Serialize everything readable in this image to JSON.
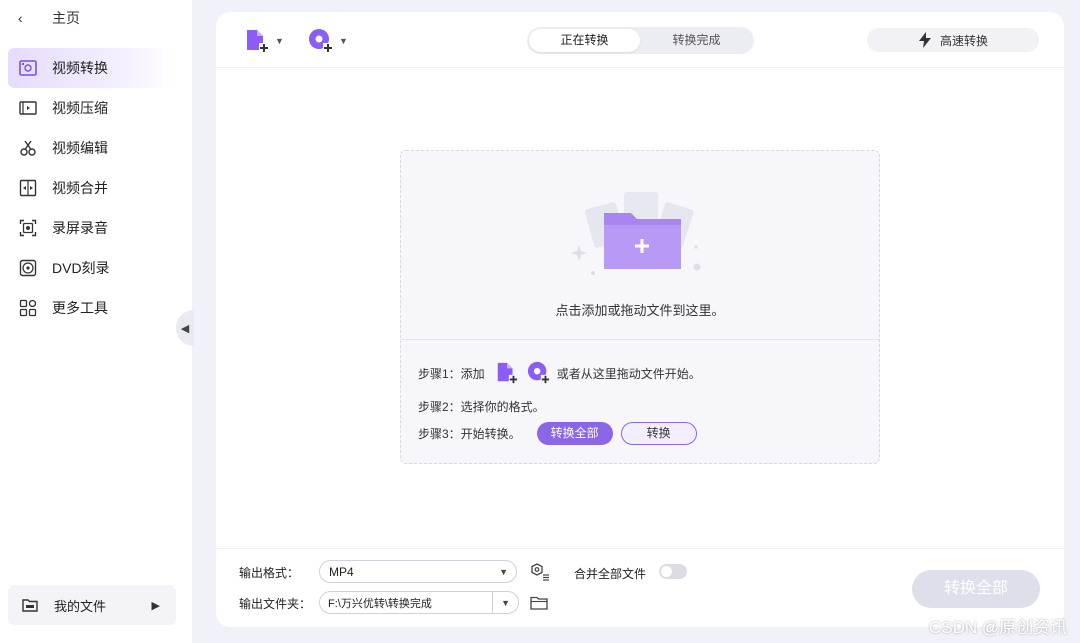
{
  "sidebar": {
    "home_label": "主页",
    "items": [
      {
        "label": "视频转换",
        "icon": "video-convert-icon"
      },
      {
        "label": "视频压缩",
        "icon": "video-compress-icon"
      },
      {
        "label": "视频编辑",
        "icon": "scissors-icon"
      },
      {
        "label": "视频合并",
        "icon": "video-merge-icon"
      },
      {
        "label": "录屏录音",
        "icon": "screen-record-icon"
      },
      {
        "label": "DVD刻录",
        "icon": "disc-icon"
      },
      {
        "label": "更多工具",
        "icon": "grid-icon"
      }
    ],
    "my_files_label": "我的文件"
  },
  "topbar": {
    "tabs": [
      {
        "label": "正在转换",
        "active": true
      },
      {
        "label": "转换完成",
        "active": false
      }
    ],
    "fast_convert_label": "高速转换"
  },
  "dropzone": {
    "hint": "点击添加或拖动文件到这里。",
    "step1_prefix": "步骤1：添加",
    "step1_suffix": "或者从这里拖动文件开始。",
    "step2": "步骤2：选择你的格式。",
    "step3": "步骤3：开始转换。",
    "convert_all_label": "转换全部",
    "convert_label": "转换"
  },
  "bottom": {
    "format_label": "输出格式：",
    "format_value": "MP4",
    "folder_label": "输出文件夹：",
    "folder_value": "F:\\万兴优转\\转换完成",
    "merge_label": "合并全部文件",
    "merge_enabled": false,
    "convert_all_label": "转换全部"
  },
  "watermark": "CSDN @原创资讯",
  "colors": {
    "accent": "#8b67e8",
    "active_nav_bg": "#e6dcff",
    "disabled_button": "#dde0ea",
    "app_bg": "#f1f2f9"
  }
}
